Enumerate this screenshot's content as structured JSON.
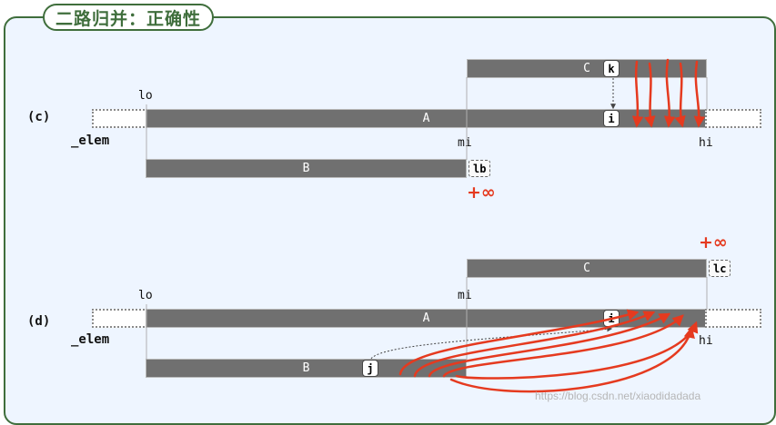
{
  "title": "二路归并：正确性",
  "panel_c": {
    "case_label": "(c)",
    "array_name": "_elem",
    "lo": "lo",
    "mi": "mi",
    "hi": "hi",
    "bar_a": "A",
    "bar_b": "B",
    "bar_c": "C",
    "cell_k": "k",
    "cell_i": "i",
    "cell_lb": "lb",
    "annotation": "+∞"
  },
  "panel_d": {
    "case_label": "(d)",
    "array_name": "_elem",
    "lo": "lo",
    "mi": "mi",
    "hi": "hi",
    "bar_a": "A",
    "bar_b": "B",
    "bar_c": "C",
    "cell_i": "i",
    "cell_j": "j",
    "cell_lc": "lc",
    "annotation": "+∞"
  },
  "watermark": "https://blog.csdn.net/xiaodidadada",
  "colors": {
    "frame": "#3f6e3c",
    "bar": "#707070",
    "background": "#eef5ff",
    "annotation": "#e53a1f"
  }
}
